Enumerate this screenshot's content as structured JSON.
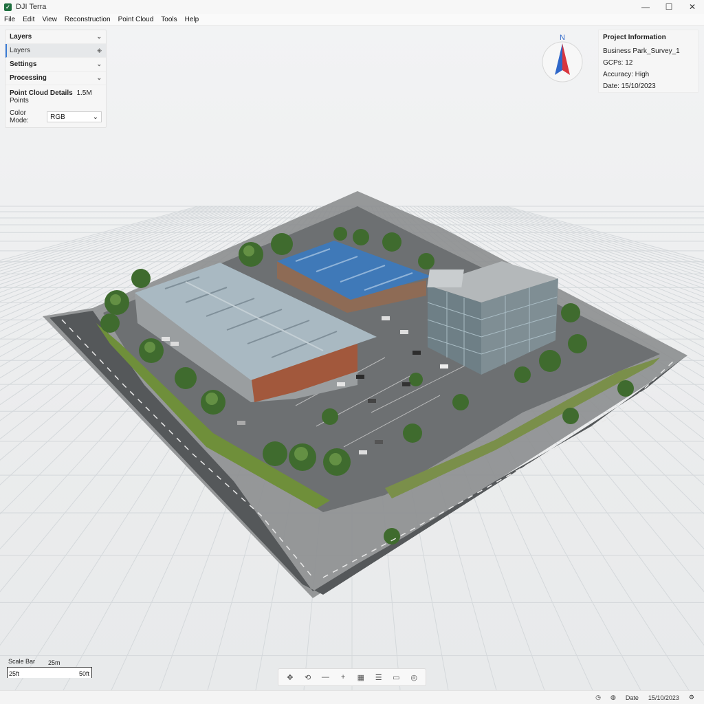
{
  "app": {
    "title": "DJI Terra"
  },
  "window_controls": {
    "minimize": "—",
    "maximize": "☐",
    "close": "✕"
  },
  "menu": [
    "File",
    "Edit",
    "View",
    "Reconstruction",
    "Point Cloud",
    "Tools",
    "Help"
  ],
  "left_panel": {
    "sections": [
      {
        "label": "Layers",
        "expanded": true
      },
      {
        "label": "Layers",
        "active": true,
        "icon": "layers-icon"
      },
      {
        "label": "Settings"
      },
      {
        "label": "Processing"
      }
    ],
    "details_title": "Point Cloud Details",
    "details_count": "1.5M Points",
    "color_mode_label": "Color Mode:",
    "color_mode_value": "RGB"
  },
  "compass": {
    "label": "N",
    "colors": {
      "north": "#d9363e",
      "south": "#2f67c9"
    }
  },
  "project_info": {
    "title": "Project Information",
    "name": "Business Park_Survey_1",
    "gcps": "GCPs: 12",
    "accuracy": "Accuracy: High",
    "date": "Date: 15/10/2023"
  },
  "scale_bar": {
    "title": "Scale Bar",
    "top_label": "25m",
    "left_label": "25ft",
    "right_label": "50ft"
  },
  "toolbar": {
    "tools": [
      {
        "name": "pan-tool-icon",
        "glyph": "✥"
      },
      {
        "name": "rotate-tool-icon",
        "glyph": "⟲"
      },
      {
        "name": "measure-line-icon",
        "glyph": "—"
      },
      {
        "name": "crosshair-icon",
        "glyph": "+"
      },
      {
        "name": "grid-view-icon",
        "glyph": "▦"
      },
      {
        "name": "layers-stack-icon",
        "glyph": "☰"
      },
      {
        "name": "screenshot-icon",
        "glyph": "▭"
      },
      {
        "name": "target-icon",
        "glyph": "◎"
      }
    ]
  },
  "status_bar": {
    "date_label": "Date",
    "date_value": "15/10/2023"
  },
  "colors": {
    "accent": "#3a7bd5",
    "roof_grey": "#a9b9c2",
    "roof_blue": "#3f79b8",
    "asphalt": "#5b5d5f",
    "grass": "#6f8f3a"
  }
}
